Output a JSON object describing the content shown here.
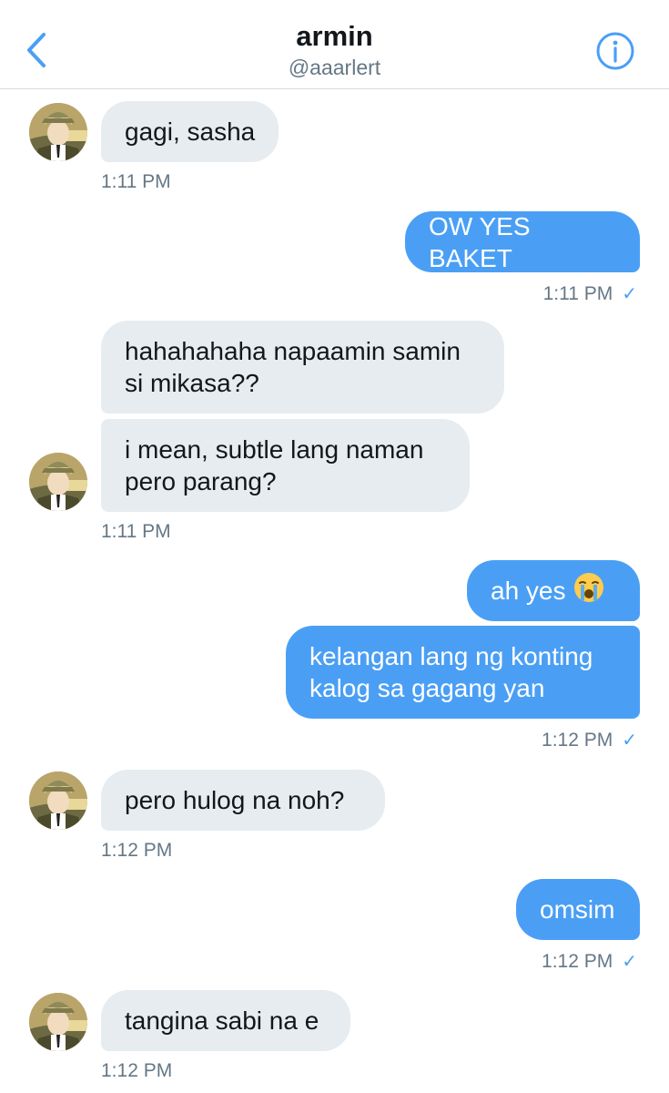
{
  "header": {
    "title": "armin",
    "handle": "@aaarlert",
    "back_icon": "chevron-left-icon",
    "info_icon": "info-circle-icon"
  },
  "colors": {
    "accent": "#4a9ff5",
    "incoming_bubble": "#e6ecf0",
    "timestamp": "#657786"
  },
  "messages": [
    {
      "id": 1,
      "direction": "in",
      "text": "gagi, sasha"
    },
    {
      "id": 2,
      "direction": "out",
      "text": "OW YES BAKET"
    },
    {
      "id": 3,
      "direction": "in",
      "text": "hahahahaha napaamin samin si mikasa??"
    },
    {
      "id": 4,
      "direction": "in",
      "text": "i mean, subtle lang naman pero parang?"
    },
    {
      "id": 5,
      "direction": "out",
      "text": "ah yes",
      "emoji": "loudly-crying-face"
    },
    {
      "id": 6,
      "direction": "out",
      "text": "kelangan lang ng konting kalog sa gagang yan"
    },
    {
      "id": 7,
      "direction": "in",
      "text": "pero hulog na noh?"
    },
    {
      "id": 8,
      "direction": "out",
      "text": "omsim"
    },
    {
      "id": 9,
      "direction": "in",
      "text": "tangina sabi na e"
    }
  ],
  "timestamps": [
    {
      "text": "1:11 PM",
      "read_receipt": false
    },
    {
      "text": "1:11 PM",
      "read_receipt": true
    },
    {
      "text": "1:11 PM",
      "read_receipt": false
    },
    {
      "text": "1:12 PM",
      "read_receipt": true
    },
    {
      "text": "1:12 PM",
      "read_receipt": false
    },
    {
      "text": "1:12 PM",
      "read_receipt": true
    },
    {
      "text": "1:12 PM",
      "read_receipt": false
    }
  ],
  "read_receipt_glyph": "✓"
}
